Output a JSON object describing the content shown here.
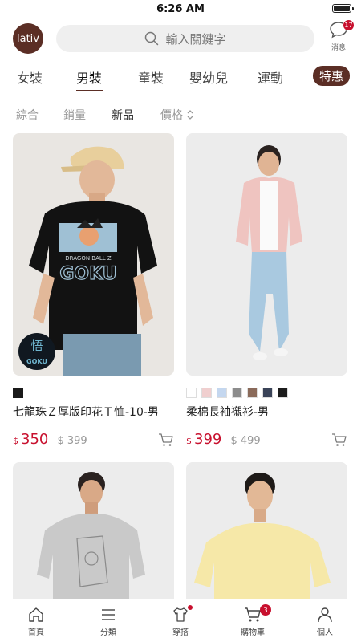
{
  "status": {
    "time": "6:26 AM",
    "battery_level": 0.9
  },
  "header": {
    "logo": "lativ",
    "search_placeholder": "輸入關鍵字",
    "messages_label": "消息",
    "messages_count": "17"
  },
  "categories": {
    "items": [
      "女裝",
      "男裝",
      "童裝",
      "嬰幼兒",
      "運動"
    ],
    "active": "男裝",
    "special": "特惠"
  },
  "sort": {
    "items": [
      "綜合",
      "銷量",
      "新品",
      "價格"
    ],
    "active": "新品"
  },
  "products": [
    {
      "name": "七龍珠Ｚ厚版印花Ｔ恤-10-男",
      "currency": "$",
      "price": "350",
      "original_price": "$ 399",
      "swatches": [
        "#1a1a1a"
      ]
    },
    {
      "name": "柔棉長袖襯衫-男",
      "currency": "$",
      "price": "399",
      "original_price": "$ 499",
      "swatches": [
        "#ffffff",
        "#f0cfcf",
        "#c4d7ef",
        "#8c8c8c",
        "#8a6a5a",
        "#3a4358",
        "#1c1c1c"
      ]
    },
    {
      "name": "",
      "price": ""
    },
    {
      "name": "",
      "price": ""
    }
  ],
  "tabbar": {
    "items": [
      "首頁",
      "分類",
      "穿搭",
      "購物車",
      "個人"
    ],
    "cart_count": "3"
  },
  "colors": {
    "brand": "#5b2e25",
    "sale": "#c8102e"
  }
}
